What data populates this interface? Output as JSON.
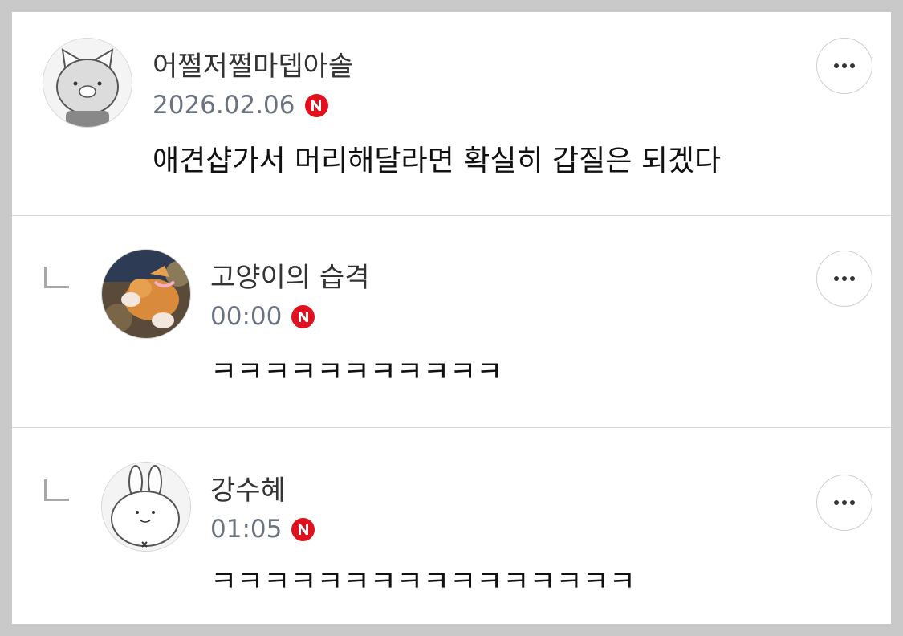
{
  "comments": [
    {
      "author": "어쩔저쩔마뎁아솔",
      "date": "2026.02.06",
      "badge": "N",
      "text": "애견샵가서 머리해달라면 확실히 갑질은 되겠다",
      "avatar": "cat-character-avatar",
      "is_reply": false
    },
    {
      "author": "고양이의 습격",
      "date": "00:00",
      "badge": "N",
      "text": "ㅋㅋㅋㅋㅋㅋㅋㅋㅋㅋㅋ",
      "avatar": "orange-cat-photo-avatar",
      "is_reply": true
    },
    {
      "author": "강수혜",
      "date": "01:05",
      "badge": "N",
      "text": "ㅋㅋㅋㅋㅋㅋㅋㅋㅋㅋㅋㅋㅋㅋㅋㅋ",
      "avatar": "rabbit-character-avatar",
      "is_reply": true
    }
  ],
  "colors": {
    "badge_red": "#e0101e",
    "meta_gray": "#6b7280",
    "background": "#c9c9c9"
  },
  "icons": {
    "more": "more-dots-icon",
    "reply": "reply-arrow-icon",
    "badge": "naver-n-badge-icon"
  }
}
